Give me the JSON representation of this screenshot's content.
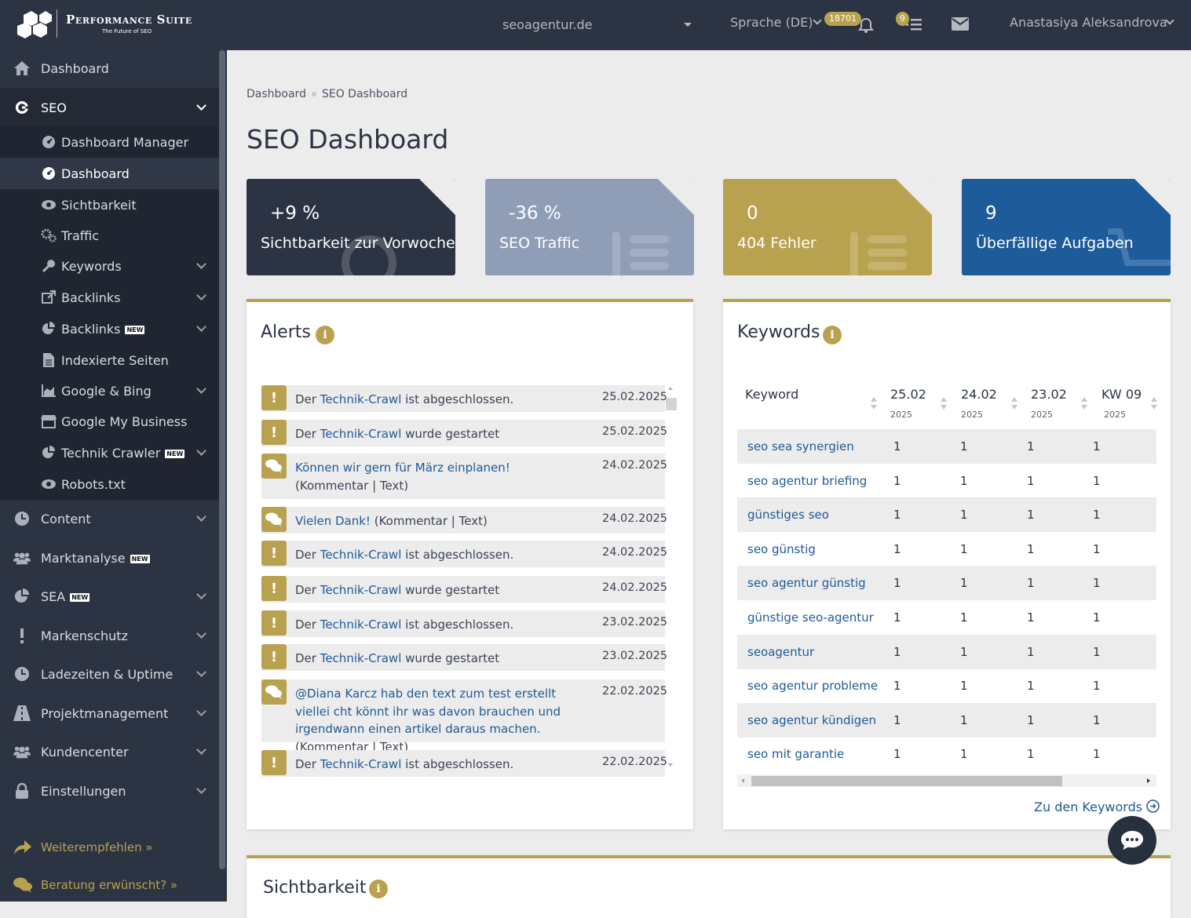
{
  "topbar": {
    "brand": "Performance Suite",
    "brand_sub": "The Future of SEO",
    "domain": "seoagentur.de",
    "language": "Sprache (DE)",
    "notifications_count": "18701",
    "tasks_count": "9",
    "user": "Anastasiya Aleksandrova"
  },
  "sidebar": {
    "items": [
      {
        "label": "Dashboard",
        "icon": "home-icon"
      },
      {
        "label": "SEO",
        "icon": "google-icon"
      },
      {
        "label": "Content",
        "icon": "clock-icon"
      },
      {
        "label": "Marktanalyse",
        "icon": "users-icon",
        "new": "NEW"
      },
      {
        "label": "SEA",
        "icon": "pie-chart-icon",
        "new": "NEW"
      },
      {
        "label": "Markenschutz",
        "icon": "exclamation-icon"
      },
      {
        "label": "Ladezeiten & Uptime",
        "icon": "clock-icon"
      },
      {
        "label": "Projektmanagement",
        "icon": "road-icon"
      },
      {
        "label": "Kundencenter",
        "icon": "users-icon"
      },
      {
        "label": "Einstellungen",
        "icon": "lock-icon"
      }
    ],
    "seo_sub": [
      {
        "label": "Dashboard Manager",
        "icon": "tachometer-icon"
      },
      {
        "label": "Dashboard",
        "icon": "tachometer-icon"
      },
      {
        "label": "Sichtbarkeit",
        "icon": "eye-icon"
      },
      {
        "label": "Traffic",
        "icon": "cogs-icon"
      },
      {
        "label": "Keywords",
        "icon": "key-icon"
      },
      {
        "label": "Backlinks",
        "icon": "external-link-icon"
      },
      {
        "label": "Backlinks",
        "icon": "pie-chart-icon",
        "new": "NEW"
      },
      {
        "label": "Indexierte Seiten",
        "icon": "file-icon"
      },
      {
        "label": "Google & Bing",
        "icon": "area-chart-icon"
      },
      {
        "label": "Google My Business",
        "icon": "store-icon"
      },
      {
        "label": "Technik Crawler",
        "icon": "pie-chart-icon",
        "new": "NEW"
      },
      {
        "label": "Robots.txt",
        "icon": "eye-icon"
      }
    ],
    "footer": [
      {
        "label": "Weiterempfehlen »",
        "icon": "share-icon"
      },
      {
        "label": "Beratung erwünscht? »",
        "icon": "comments-icon"
      }
    ]
  },
  "breadcrumb": [
    "Dashboard",
    "SEO Dashboard"
  ],
  "page_title": "SEO Dashboard",
  "kpis": [
    {
      "value": "+9 %",
      "label": "Sichtbarkeit zur Vorwoche",
      "color": "#2c3443"
    },
    {
      "value": "-36 %",
      "label": "SEO Traffic",
      "color": "#8f9db6"
    },
    {
      "value": "0",
      "label": "404 Fehler",
      "color": "#b9a24f"
    },
    {
      "value": "9",
      "label": "Überfällige Aufgaben",
      "color": "#1d5b9a"
    }
  ],
  "alerts": {
    "title": "Alerts",
    "items": [
      {
        "type": "exclamation",
        "pre": "Der ",
        "link": "Technik-Crawl",
        "post": " ist abgeschlossen.",
        "date": "25.02.2025"
      },
      {
        "type": "exclamation",
        "pre": "Der ",
        "link": "Technik-Crawl",
        "post": " wurde gestartet",
        "date": "25.02.2025"
      },
      {
        "type": "comment",
        "pre": "",
        "link": "Können wir gern für März einplanen!",
        "post": " (Kommentar | Text)",
        "date": "24.02.2025"
      },
      {
        "type": "comment",
        "pre": "",
        "link": "Vielen Dank!",
        "post": " (Kommentar | Text)",
        "date": "24.02.2025"
      },
      {
        "type": "exclamation",
        "pre": "Der ",
        "link": "Technik-Crawl",
        "post": " ist abgeschlossen.",
        "date": "24.02.2025"
      },
      {
        "type": "exclamation",
        "pre": "Der ",
        "link": "Technik-Crawl",
        "post": " wurde gestartet",
        "date": "24.02.2025"
      },
      {
        "type": "exclamation",
        "pre": "Der ",
        "link": "Technik-Crawl",
        "post": " ist abgeschlossen.",
        "date": "23.02.2025"
      },
      {
        "type": "exclamation",
        "pre": "Der ",
        "link": "Technik-Crawl",
        "post": " wurde gestartet",
        "date": "23.02.2025"
      },
      {
        "type": "comment",
        "pre": "",
        "link": "@Diana Karcz  hab den text zum test erstellt viellei cht könnt ihr was davon brauchen und irgendwann einen artikel daraus machen.",
        "post": " (Kommentar | Text)",
        "date": "22.02.2025"
      },
      {
        "type": "exclamation",
        "pre": "Der ",
        "link": "Technik-Crawl",
        "post": " ist abgeschlossen.",
        "date": "22.02.2025"
      }
    ]
  },
  "keywords": {
    "title": "Keywords",
    "columns": [
      {
        "label": "Keyword",
        "sub": ""
      },
      {
        "label": "25.02",
        "sub": "2025"
      },
      {
        "label": "24.02",
        "sub": "2025"
      },
      {
        "label": "23.02",
        "sub": "2025"
      },
      {
        "label": "KW 09",
        "sub": "2025"
      }
    ],
    "rows": [
      {
        "keyword": "seo sea synergien",
        "values": [
          "1",
          "1",
          "1",
          "1"
        ]
      },
      {
        "keyword": "seo agentur briefing",
        "values": [
          "1",
          "1",
          "1",
          "1"
        ]
      },
      {
        "keyword": "günstiges seo",
        "values": [
          "1",
          "1",
          "1",
          "1"
        ]
      },
      {
        "keyword": "seo günstig",
        "values": [
          "1",
          "1",
          "1",
          "1"
        ]
      },
      {
        "keyword": "seo agentur günstig",
        "values": [
          "1",
          "1",
          "1",
          "1"
        ]
      },
      {
        "keyword": "günstige seo-agentur",
        "values": [
          "1",
          "1",
          "1",
          "1"
        ]
      },
      {
        "keyword": "seoagentur",
        "values": [
          "1",
          "1",
          "1",
          "1"
        ]
      },
      {
        "keyword": "seo agentur probleme",
        "values": [
          "1",
          "1",
          "1",
          "1"
        ]
      },
      {
        "keyword": "seo agentur kündigen",
        "values": [
          "1",
          "1",
          "1",
          "1"
        ]
      },
      {
        "keyword": "seo mit garantie",
        "values": [
          "1",
          "1",
          "1",
          "1"
        ]
      }
    ],
    "more_link": "Zu den Keywords"
  },
  "sichtbarkeit": {
    "title": "Sichtbarkeit"
  },
  "colors": {
    "accent": "#b9a24f",
    "sidebar": "#2c3443",
    "link": "#1f5a96"
  }
}
